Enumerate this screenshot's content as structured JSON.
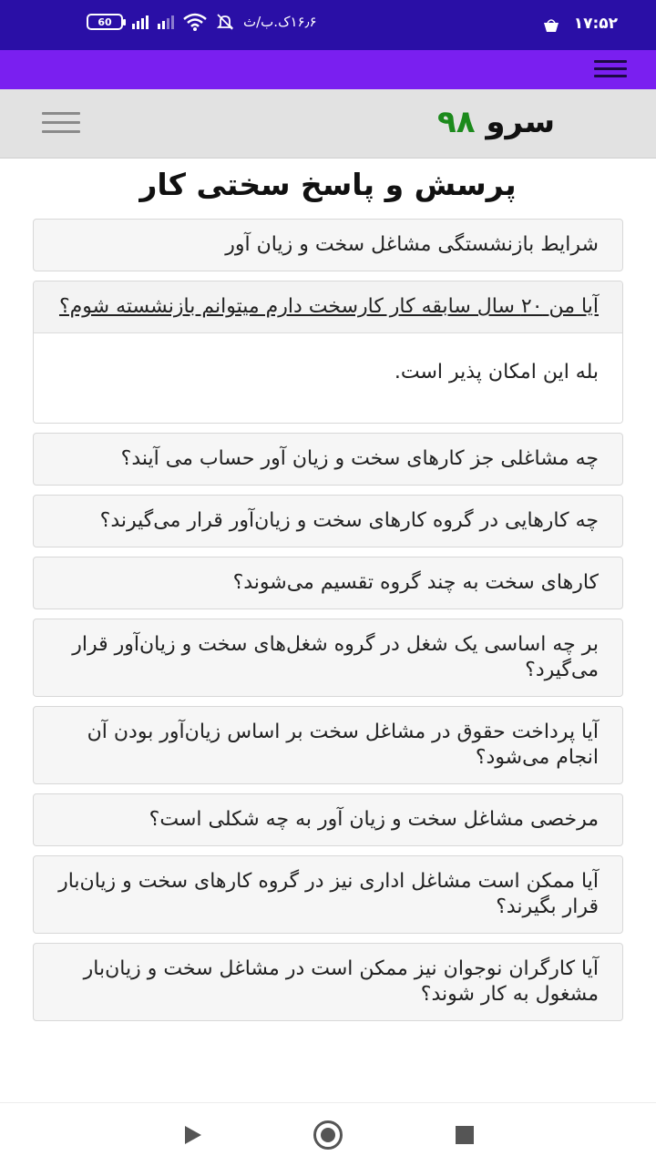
{
  "status_bar": {
    "time": "۱۷:۵۲",
    "data_speed": "۱۶٫۶ک.ب/ث",
    "battery": "60",
    "icons": [
      "shopping-bag-icon",
      "mute-icon",
      "wifi-icon",
      "signal-icon",
      "battery-icon"
    ]
  },
  "app_bar": {
    "menu_icon": "hamburger-icon"
  },
  "header": {
    "logo_word1": "سرو",
    "logo_word2": "۹۸",
    "menu_icon": "hamburger-icon"
  },
  "page": {
    "title": "پرسش و پاسخ سختی کار"
  },
  "faq": [
    {
      "question": "شرایط بازنشستگی مشاغل سخت و زیان آور"
    },
    {
      "question": "آیا من ۲۰ سال سابقه کار کارسخت دارم میتوانم بازنشسته شوم؟",
      "answer": "بله این امکان پذیر است."
    },
    {
      "question": "چه مشاغلی جز کارهای سخت و زیان آور حساب می آیند؟"
    },
    {
      "question": "چه کارهایی در گروه کارهای سخت و زیان‌آور قرار می‌گیرند؟"
    },
    {
      "question": "کارهای سخت به چند گروه تقسیم می‌شوند؟"
    },
    {
      "question": "بر چه اساسی یک شغل در گروه شغل‌های سخت و زیان‌آور قرار می‌گیرد؟"
    },
    {
      "question": "آیا پرداخت حقوق در مشاغل سخت بر اساس زیان‌آور بودن آن انجام می‌شود؟"
    },
    {
      "question": "مرخصی مشاغل سخت و زیان آور به چه شکلی است؟"
    },
    {
      "question": "آیا ممکن است مشاغل اداری نیز در گروه کارهای سخت و زیان‌بار قرار بگیرند؟"
    },
    {
      "question": "آیا کارگران نوجوان نیز ممکن است در مشاغل سخت و زیان‌بار مشغول به کار شوند؟"
    }
  ],
  "nav_bar": {
    "icons": [
      "back-icon",
      "home-icon",
      "recents-icon"
    ]
  },
  "colors": {
    "status_bar": "#2a0fa6",
    "app_bar": "#7a1ff0",
    "logo_green": "#1c8a1c"
  }
}
